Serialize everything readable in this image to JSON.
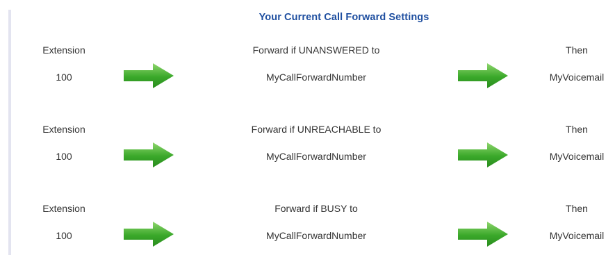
{
  "title": "Your Current Call Forward Settings",
  "rows": [
    {
      "extension_label": "Extension",
      "extension_value": "100",
      "forward_label": "Forward if UNANSWERED to",
      "forward_value": "MyCallForwardNumber",
      "then_label": "Then",
      "then_value": "MyVoicemail"
    },
    {
      "extension_label": "Extension",
      "extension_value": "100",
      "forward_label": "Forward if UNREACHABLE to",
      "forward_value": "MyCallForwardNumber",
      "then_label": "Then",
      "then_value": "MyVoicemail"
    },
    {
      "extension_label": "Extension",
      "extension_value": "100",
      "forward_label": "Forward if BUSY to",
      "forward_value": "MyCallForwardNumber",
      "then_label": "Then",
      "then_value": "MyVoicemail"
    }
  ],
  "icons": {
    "arrow": "arrow-right-icon"
  },
  "colors": {
    "title": "#1f4fa0",
    "text": "#333333",
    "arrow_green": "#3aa82a",
    "arrow_light": "#8fd66d",
    "left_rule": "#e3e4f0"
  }
}
